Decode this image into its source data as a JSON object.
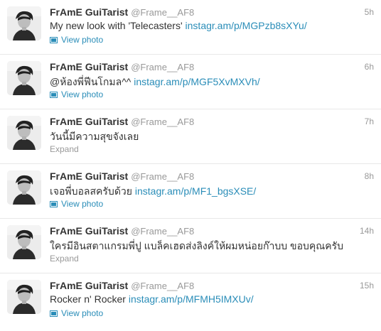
{
  "colors": {
    "link": "#2a8db8",
    "muted": "#999999",
    "text": "#333333",
    "divider": "#e8e8e8"
  },
  "tweets": [
    {
      "fullname": "FrAmE GuiTarist",
      "username": "@Frame__AF8",
      "time": "5h",
      "text": "My new look with 'Telecasters' ",
      "link": "instagr.am/p/MGPzb8sXYu/",
      "action": "View photo",
      "action_icon": "photo-icon"
    },
    {
      "fullname": "FrAmE GuiTarist",
      "username": "@Frame__AF8",
      "time": "6h",
      "text": "@ห้องพี่ฟีนโกมล^^ ",
      "link": "instagr.am/p/MGF5XvMXVh/",
      "action": "View photo",
      "action_icon": "photo-icon"
    },
    {
      "fullname": "FrAmE GuiTarist",
      "username": "@Frame__AF8",
      "time": "7h",
      "text": "วันนี้มีความสุขจังเลย",
      "link": "",
      "action": "Expand",
      "action_icon": ""
    },
    {
      "fullname": "FrAmE GuiTarist",
      "username": "@Frame__AF8",
      "time": "8h",
      "text": "เจอพี่บอลสครับด้วย ",
      "link": "instagr.am/p/MF1_bgsXSE/",
      "action": "View photo",
      "action_icon": "photo-icon"
    },
    {
      "fullname": "FrAmE GuiTarist",
      "username": "@Frame__AF8",
      "time": "14h",
      "text": "ใครมีอินสตาแกรมพี่ปู แบล็คเฮดส่งลิงค์ให้ผมหน่อยก๊าบบ ขอบคุณครับ",
      "link": "",
      "action": "Expand",
      "action_icon": ""
    },
    {
      "fullname": "FrAmE GuiTarist",
      "username": "@Frame__AF8",
      "time": "15h",
      "text": "Rocker n' Rocker ",
      "link": "instagr.am/p/MFMH5IMXUv/",
      "action": "View photo",
      "action_icon": "photo-icon"
    }
  ]
}
